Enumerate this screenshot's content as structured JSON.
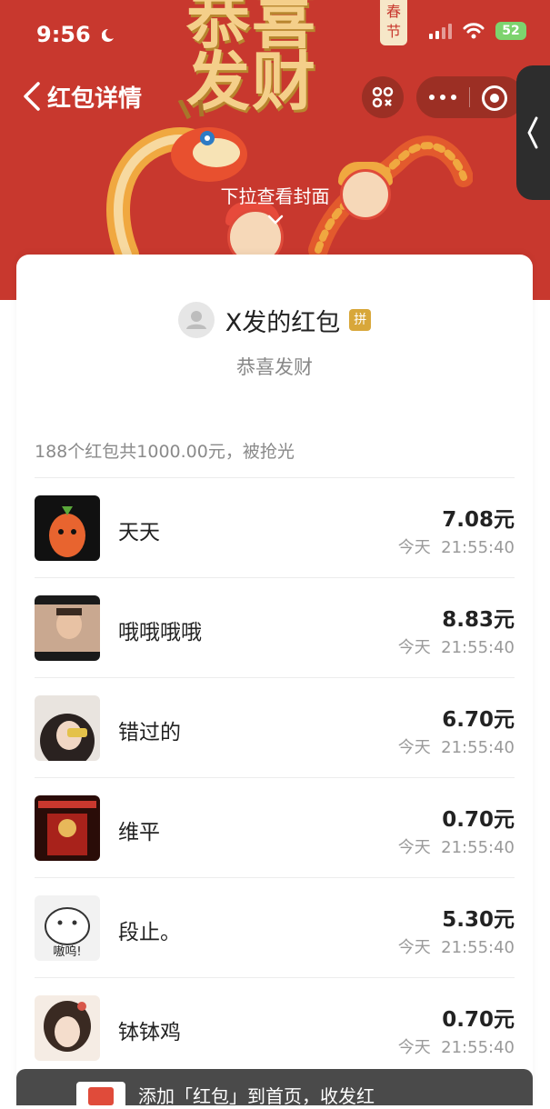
{
  "status_bar": {
    "time": "9:56",
    "battery": "52"
  },
  "cover": {
    "deco_line1": "恭喜",
    "deco_line2": "发财",
    "deco_tag": "春节",
    "pull_hint": "下拉查看封面"
  },
  "nav": {
    "title": "红包详情"
  },
  "card": {
    "sender_name": "X发的红包",
    "badge": "拼",
    "greeting": "恭喜发财",
    "summary": "188个红包共1000.00元，被抢光"
  },
  "recipients": [
    {
      "name": "天天",
      "amount": "7.08元",
      "day": "今天",
      "time": "21:55:40"
    },
    {
      "name": "哦哦哦哦",
      "amount": "8.83元",
      "day": "今天",
      "time": "21:55:40"
    },
    {
      "name": "错过的",
      "amount": "6.70元",
      "day": "今天",
      "time": "21:55:40"
    },
    {
      "name": "维平",
      "amount": "0.70元",
      "day": "今天",
      "time": "21:55:40"
    },
    {
      "name": "段止。",
      "amount": "5.30元",
      "day": "今天",
      "time": "21:55:40"
    },
    {
      "name": "钵钵鸡",
      "amount": "0.70元",
      "day": "今天",
      "time": "21:55:40"
    }
  ],
  "toast": {
    "text": "添加「红包」到首页，收发红"
  },
  "colors": {
    "cover_red": "#c8382e",
    "gold": "#f4cf8a",
    "badge_gold": "#d8a73a"
  }
}
